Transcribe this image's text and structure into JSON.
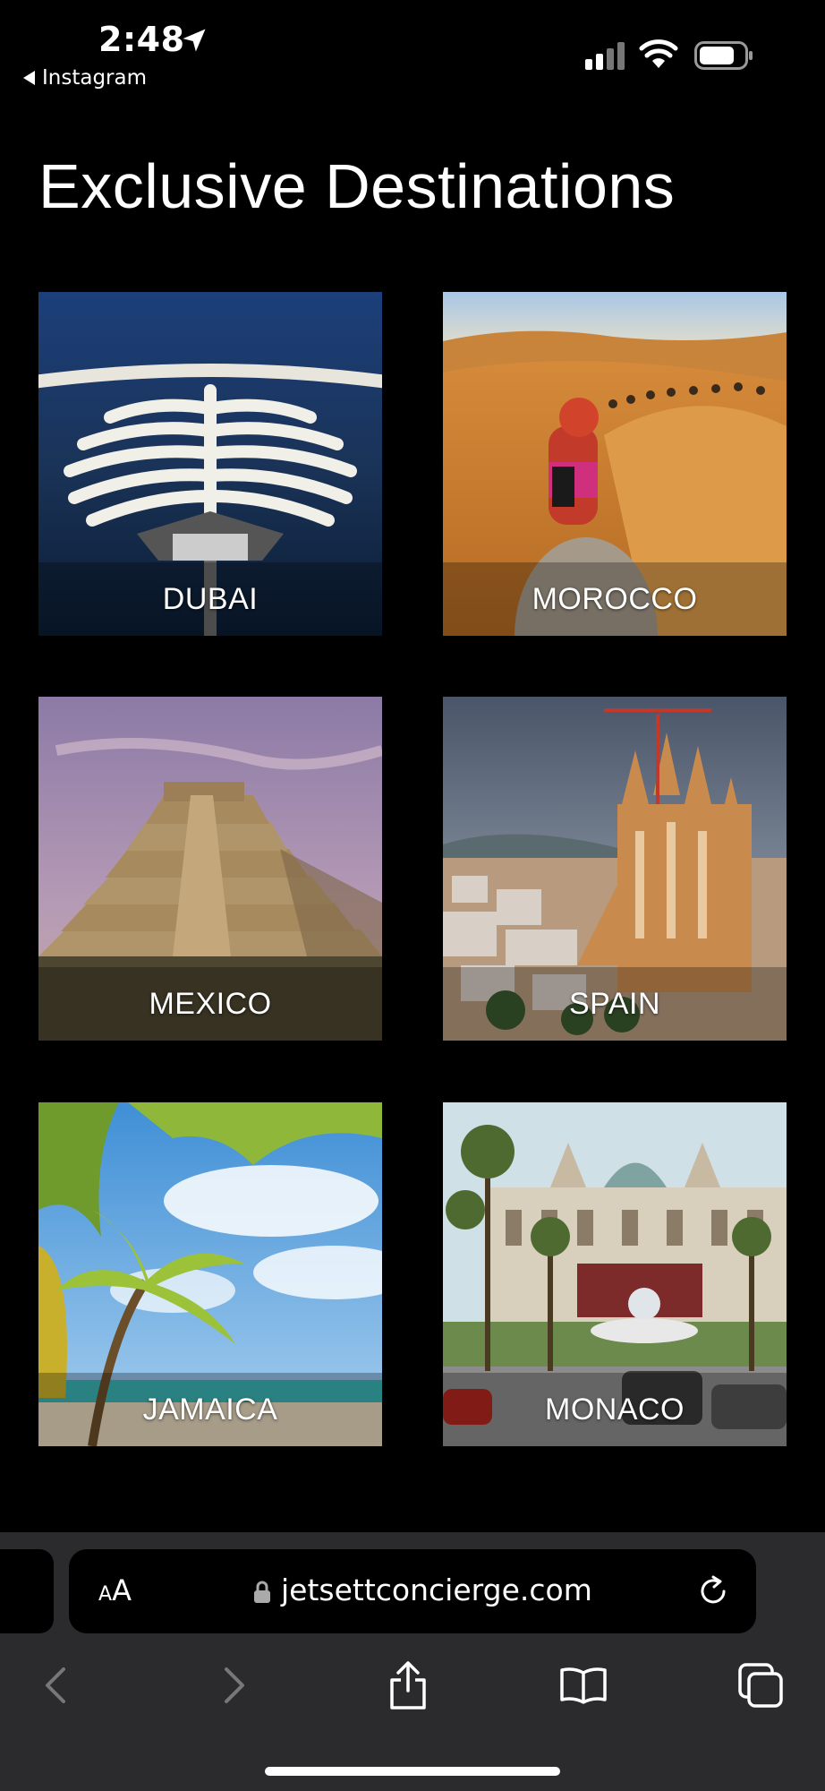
{
  "status_bar": {
    "time": "2:48",
    "back_app": "Instagram"
  },
  "page": {
    "title": "Exclusive Destinations"
  },
  "destinations": [
    {
      "name": "DUBAI"
    },
    {
      "name": "MOROCCO"
    },
    {
      "name": "MEXICO"
    },
    {
      "name": "SPAIN"
    },
    {
      "name": "JAMAICA"
    },
    {
      "name": "MONACO"
    }
  ],
  "browser": {
    "text_size_button": "AA",
    "url": "jetsettconcierge.com"
  },
  "icons": [
    "location-arrow-icon",
    "back-triangle-icon",
    "signal-icon",
    "wifi-icon",
    "battery-icon",
    "lock-icon",
    "reload-icon",
    "back-chevron-icon",
    "forward-chevron-icon",
    "share-icon",
    "bookmarks-icon",
    "tabs-icon"
  ]
}
